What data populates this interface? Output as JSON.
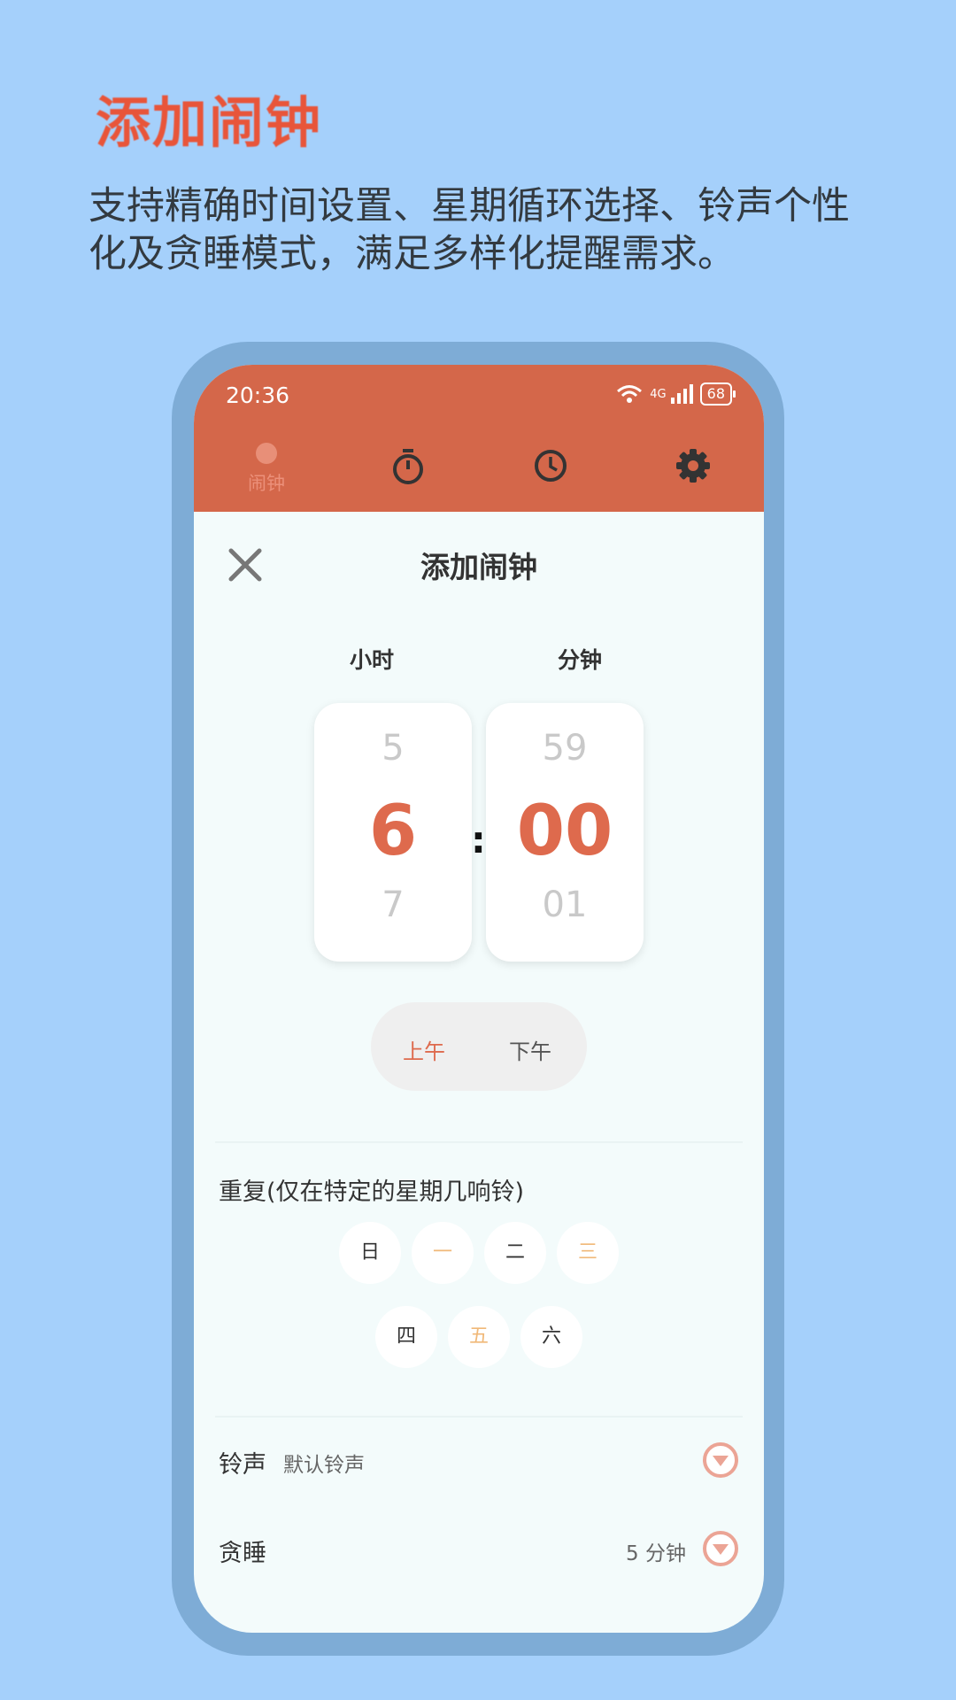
{
  "promo": {
    "title": "添加闹钟",
    "subtitle_line1": "支持精确时间设置、星期循环选择、铃声个性",
    "subtitle_line2": "化及贪睡模式，满足多样化提醒需求。"
  },
  "status_bar": {
    "time": "20:36",
    "network": "4G",
    "battery": "68"
  },
  "tabs": [
    {
      "label": "闹钟",
      "icon": "alarm-dot-icon",
      "active": true
    },
    {
      "icon": "stopwatch-icon"
    },
    {
      "icon": "clock-icon"
    },
    {
      "icon": "gear-icon"
    }
  ],
  "dialog": {
    "title": "添加闹钟",
    "close_icon": "close-icon",
    "hour_label": "小时",
    "minute_label": "分钟",
    "hour": {
      "prev": "5",
      "current": "6",
      "next": "7"
    },
    "minute": {
      "prev": "59",
      "current": "00",
      "next": "01"
    },
    "separator": ":",
    "am_label": "上午",
    "pm_label": "下午",
    "period_selected": "上午",
    "repeat_label": "重复(仅在特定的星期几响铃)",
    "days": [
      {
        "label": "日",
        "selected": false
      },
      {
        "label": "一",
        "selected": true
      },
      {
        "label": "二",
        "selected": false
      },
      {
        "label": "三",
        "selected": true
      },
      {
        "label": "四",
        "selected": false
      },
      {
        "label": "五",
        "selected": true
      },
      {
        "label": "六",
        "selected": false
      }
    ],
    "ringtone_label": "铃声",
    "ringtone_value": "默认铃声",
    "snooze_label": "贪睡",
    "snooze_value": "5 分钟"
  },
  "colors": {
    "accent": "#d4674a",
    "accent_text": "#de6a4d",
    "selected_day": "#f0b878",
    "background": "#a5d0fb"
  }
}
